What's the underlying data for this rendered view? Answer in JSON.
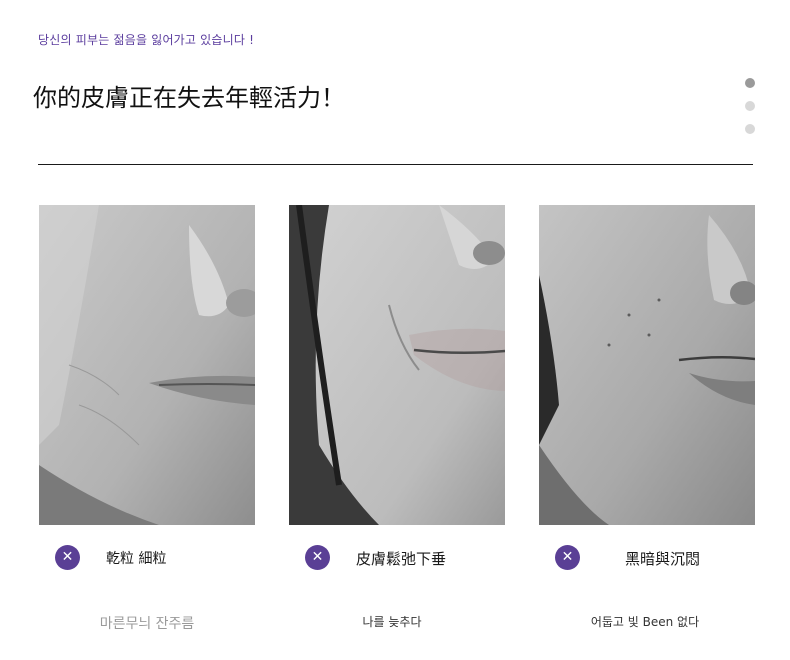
{
  "header": {
    "subtitle": "당신의 피부는 젊음을 잃어가고 있습니다 !",
    "title": "你的皮膚正在失去年輕活力！"
  },
  "pager": {
    "dots": 3,
    "active_index": 0
  },
  "cards": [
    {
      "x_icon": "✕",
      "label": "乾粒 細粒",
      "caption": "마른무늬 잔주름"
    },
    {
      "x_icon": "✕",
      "label": "皮膚鬆弛下垂",
      "caption": "나를 늦추다"
    },
    {
      "x_icon": "✕",
      "label": "黑暗與沉悶",
      "caption": "어둡고 빛 Been 없다"
    }
  ],
  "colors": {
    "accent": "#5a3f95",
    "subtitle": "#5b3d9e",
    "rule": "#1a1a1a"
  }
}
